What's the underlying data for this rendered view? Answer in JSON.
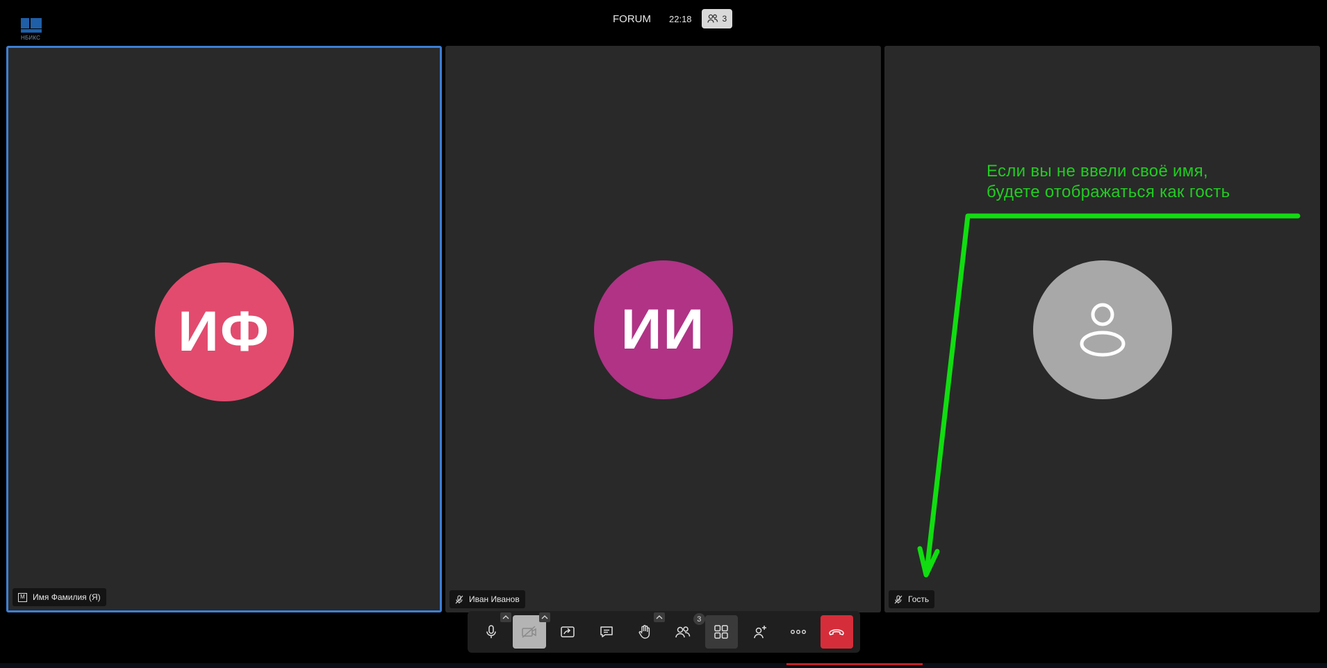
{
  "logo": {
    "text": "НБИКС",
    "color": "#1f5fa8"
  },
  "header": {
    "title": "FORUM",
    "time": "22:18",
    "participant_count": "3",
    "participants_icon": "participants-icon"
  },
  "tiles": [
    {
      "initials": "ИФ",
      "name": "Имя Фамилия (Я)",
      "avatar_color": "#e24b6e",
      "active": true,
      "badge": "M",
      "mic": "moderator-badge-icon"
    },
    {
      "initials": "ИИ",
      "name": "Иван Иванов",
      "avatar_color": "#b03386",
      "active": false,
      "mic": "mic-off-icon"
    },
    {
      "initials": "",
      "name": "Гость",
      "avatar_color": "#a8a8a8",
      "active": false,
      "mic": "mic-off-icon",
      "avatar_icon": "user-icon"
    }
  ],
  "annotation": {
    "line1": "Если вы не ввели своё имя,",
    "line2": "будете отображаться как гость",
    "color": "#22cc22"
  },
  "toolbar": {
    "buttons": [
      {
        "name": "microphone-button",
        "icon": "microphone-icon"
      },
      {
        "name": "camera-button",
        "icon": "camera-off-icon",
        "state": "muted"
      },
      {
        "name": "share-screen-button",
        "icon": "share-screen-icon"
      },
      {
        "name": "chat-button",
        "icon": "chat-icon"
      },
      {
        "name": "raise-hand-button",
        "icon": "hand-icon"
      },
      {
        "name": "participants-button",
        "icon": "participants-icon",
        "count": "3"
      },
      {
        "name": "tile-view-button",
        "icon": "grid-icon",
        "state": "active"
      },
      {
        "name": "invite-button",
        "icon": "add-person-icon"
      },
      {
        "name": "more-button",
        "icon": "more-icon"
      },
      {
        "name": "hangup-button",
        "icon": "hangup-icon",
        "color": "#d62d3a"
      }
    ]
  },
  "colors": {
    "tile_bg": "#292929",
    "active_border": "#3d7fd6"
  }
}
